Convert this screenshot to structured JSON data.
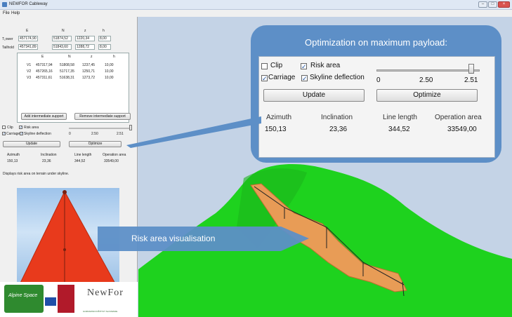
{
  "window": {
    "title": "NEWFOR Cableway"
  },
  "menu": [
    "File",
    "Help"
  ],
  "top_table": {
    "headers": [
      "E",
      "N",
      "z",
      "h"
    ],
    "rows": [
      {
        "label": "T₁ower",
        "values": [
          "457174,90",
          "51874,52",
          "1220,34",
          "8,00"
        ]
      },
      {
        "label": "Tailhold",
        "values": [
          "457341,89",
          "51843,60",
          "1288,72",
          "8,00"
        ]
      }
    ]
  },
  "support_table": {
    "headers": [
      "E",
      "N",
      "z",
      "h"
    ],
    "rows": [
      {
        "label": "V1",
        "values": [
          "457317,94",
          "51808,58",
          "1237,45",
          "10,00"
        ]
      },
      {
        "label": "V2",
        "values": [
          "457265,16",
          "51717,35",
          "1250,71",
          "10,00"
        ]
      },
      {
        "label": "V3",
        "values": [
          "457311,61",
          "51638,31",
          "1273,72",
          "10,00"
        ]
      }
    ]
  },
  "buttons": {
    "add_support": "Add intermediate support",
    "remove_support": "Remove intermediate support",
    "update": "Update",
    "optimize": "Optimize"
  },
  "checkboxes": {
    "clip": {
      "label": "Clip",
      "checked": false
    },
    "risk_area": {
      "label": "Risk area",
      "checked": true
    },
    "carriage": {
      "label": "Carriage",
      "checked": true
    },
    "skyline_deflection": {
      "label": "Skyline deflection",
      "checked": true
    }
  },
  "slider": {
    "min": "0",
    "value": "2.50",
    "max": "2.51",
    "fraction": 0.996
  },
  "results": {
    "headers": [
      "Azimuth",
      "Inclination",
      "Line length",
      "Operation area"
    ],
    "values": [
      "150,13",
      "23,36",
      "344,52",
      "33549,00"
    ]
  },
  "status_text": "Displays risk area on terrain under skyline.",
  "callout": {
    "title": "Optimization on maximum payload:"
  },
  "annotation": {
    "risk_label": "Risk area visualisation"
  },
  "logos": {
    "alpine": "Alpine Space",
    "newfor": "NewFor",
    "institute": "GOZDARSKI INŠTITUT SLOVENIJE"
  },
  "colors": {
    "accent_blue": "#5d8fc7",
    "terrain_green": "#1ed21e",
    "risk_red": "#e83a1c",
    "risk_orange": "#f39a5a"
  }
}
